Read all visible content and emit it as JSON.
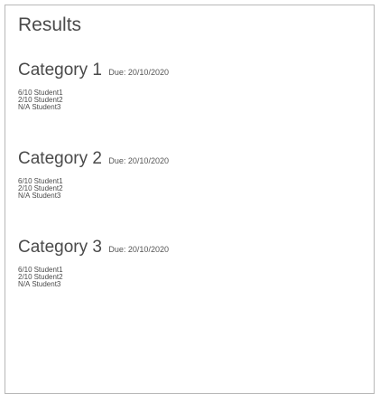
{
  "page": {
    "title": "Results"
  },
  "categories": [
    {
      "name": "Category 1",
      "due": "Due: 20/10/2020",
      "rows": [
        {
          "score": "6/10",
          "student": "Student1"
        },
        {
          "score": "2/10",
          "student": "Student2"
        },
        {
          "score": "N/A",
          "student": "Student3"
        }
      ]
    },
    {
      "name": "Category 2",
      "due": "Due: 20/10/2020",
      "rows": [
        {
          "score": "6/10",
          "student": "Student1"
        },
        {
          "score": "2/10",
          "student": "Student2"
        },
        {
          "score": "N/A",
          "student": "Student3"
        }
      ]
    },
    {
      "name": "Category 3",
      "due": "Due: 20/10/2020",
      "rows": [
        {
          "score": "6/10",
          "student": "Student1"
        },
        {
          "score": "2/10",
          "student": "Student2"
        },
        {
          "score": "N/A",
          "student": "Student3"
        }
      ]
    }
  ]
}
